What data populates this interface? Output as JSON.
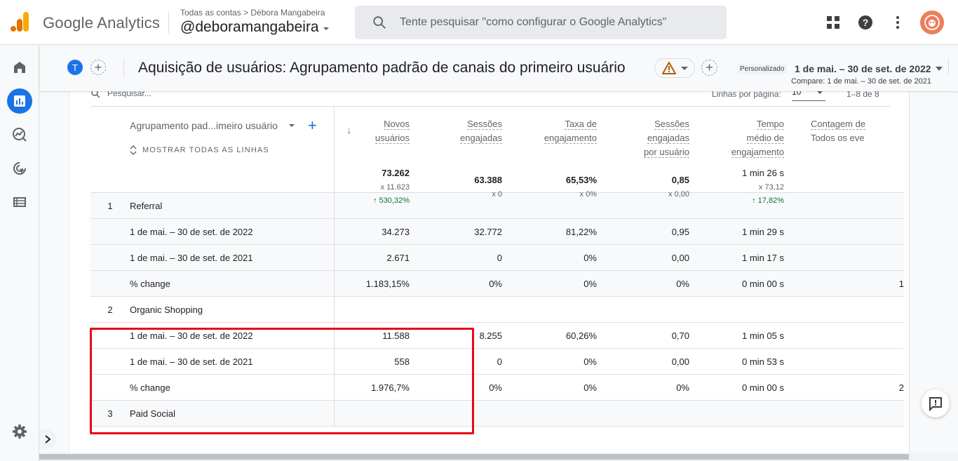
{
  "app": {
    "brand": "Google Analytics",
    "account_breadcrumb": "Todas as contas > Débora Mangabeira",
    "account_name": "@deboramangabeira",
    "search_placeholder": "Tente pesquisar \"como configurar o Google Analytics\"",
    "icons": {
      "apps": "apps-grid-icon",
      "help": "help-icon",
      "more": "more-vert-icon",
      "avatar": "user-avatar"
    },
    "colors": {
      "accent": "#1a73e8",
      "positive": "#137333",
      "highlight": "#e50914",
      "avatar": "#ee7d5a"
    }
  },
  "nav": {
    "items": [
      {
        "name": "home",
        "icon": "home-icon"
      },
      {
        "name": "reports",
        "icon": "bar-chart-icon",
        "active": true
      },
      {
        "name": "explore",
        "icon": "explore-icon"
      },
      {
        "name": "advertising",
        "icon": "advertising-icon"
      },
      {
        "name": "configure",
        "icon": "list-icon"
      }
    ],
    "settings_icon": "gear-icon"
  },
  "report": {
    "compare_chip": "T",
    "title": "Aquisição de usuários: Agrupamento padrão de canais do primeiro usuário",
    "date_preset": "Personalizado",
    "date_range": "1 de mai. – 30 de set. de 2022",
    "compare_range": "Compare: 1 de mai. – 30 de set. de 2021"
  },
  "table": {
    "search_placeholder": "Pesquisar...",
    "rows_per_page_label": "Linhas por página:",
    "rows_per_page": "10",
    "pager": "1–8 de 8",
    "dimension_label": "Agrupamento pad...imeiro usuário",
    "show_all_label": "MOSTRAR TODAS AS LINHAS",
    "columns": [
      {
        "label_lines": [
          "Novos",
          "usuários"
        ],
        "total": "73.262",
        "compare": "x 11.623",
        "change": "↑ 530,32%"
      },
      {
        "label_lines": [
          "Sessões",
          "engajadas"
        ],
        "total": "63.388",
        "compare": "x 0",
        "change": ""
      },
      {
        "label_lines": [
          "Taxa de",
          "engajamento"
        ],
        "total": "65,53%",
        "compare": "x 0%",
        "change": ""
      },
      {
        "label_lines": [
          "Sessões",
          "engajadas",
          "por usuário"
        ],
        "total": "0,85",
        "compare": "x 0,00",
        "change": ""
      },
      {
        "label_lines": [
          "Tempo",
          "médio de",
          "engajamento"
        ],
        "total": "1 min 26 s",
        "compare": "x 73,12",
        "change": "↑ 17,82%"
      },
      {
        "label_lines": [
          "Contagem de",
          "Todos os eve"
        ],
        "total": "",
        "compare": "",
        "change": ""
      }
    ],
    "groups": [
      {
        "index": "1",
        "name": "Referral",
        "rows": [
          {
            "label": "1 de mai. – 30 de set. de 2022",
            "values": [
              "34.273",
              "32.772",
              "81,22%",
              "0,95",
              "1 min 29 s"
            ],
            "cut": ""
          },
          {
            "label": "1 de mai. – 30 de set. de 2021",
            "values": [
              "2.671",
              "0",
              "0%",
              "0,00",
              "1 min 17 s"
            ],
            "cut": ""
          },
          {
            "label": "% change",
            "values": [
              "1.183,15%",
              "0%",
              "0%",
              "0%",
              "0 min 00 s"
            ],
            "cut": "1"
          }
        ]
      },
      {
        "index": "2",
        "name": "Organic Shopping",
        "rows": [
          {
            "label": "1 de mai. – 30 de set. de 2022",
            "values": [
              "11.588",
              "8.255",
              "60,26%",
              "0,70",
              "1 min 05 s"
            ],
            "cut": ""
          },
          {
            "label": "1 de mai. – 30 de set. de 2021",
            "values": [
              "558",
              "0",
              "0%",
              "0,00",
              "0 min 53 s"
            ],
            "cut": ""
          },
          {
            "label": "% change",
            "values": [
              "1.976,7%",
              "0%",
              "0%",
              "0%",
              "0 min 00 s"
            ],
            "cut": "2"
          }
        ]
      },
      {
        "index": "3",
        "name": "Paid Social",
        "rows": []
      }
    ]
  }
}
